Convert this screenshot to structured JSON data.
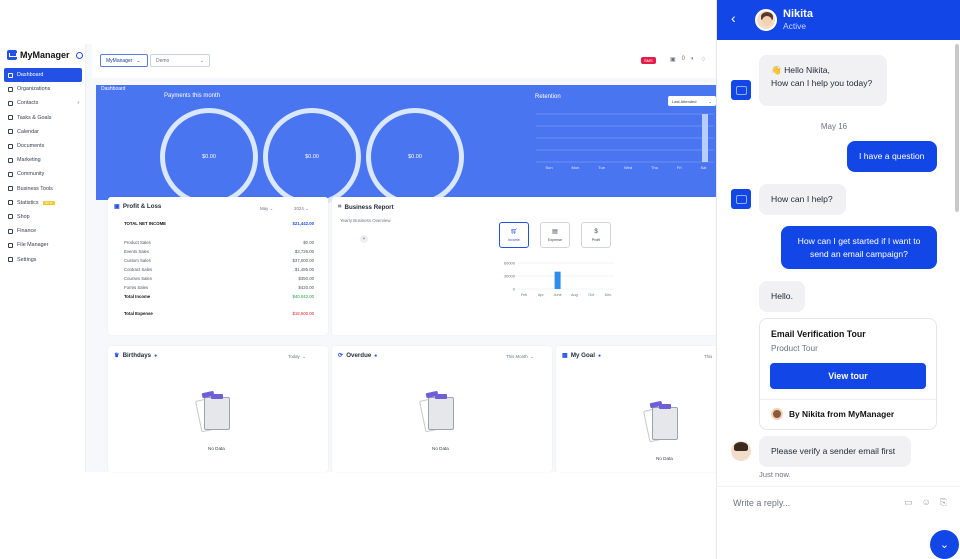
{
  "app": {
    "logo": "MyManager",
    "nav": [
      {
        "label": "Dashboard",
        "active": true
      },
      {
        "label": "Organizations"
      },
      {
        "label": "Contacts",
        "chevron": true
      },
      {
        "label": "Tasks & Goals"
      },
      {
        "label": "Calendar"
      },
      {
        "label": "Documents"
      },
      {
        "label": "Marketing"
      },
      {
        "label": "Community"
      },
      {
        "label": "Business Tools"
      },
      {
        "label": "Statistics",
        "badge": "NEW"
      },
      {
        "label": "Shop"
      },
      {
        "label": "Finance"
      },
      {
        "label": "File Manager"
      },
      {
        "label": "Settings"
      }
    ],
    "topbar": {
      "select1": "MyManager",
      "select2": "Demo",
      "yt_label": "SMS",
      "bell_count": "0"
    },
    "hero": {
      "section_label": "Dashboard",
      "payments_title": "Payments this month",
      "rings": [
        "$0.00",
        "$0.00",
        "$0.00"
      ],
      "retention_title": "Retention",
      "retention_select": "Last Attended",
      "retention_days": [
        "Sun",
        "Mon",
        "Tue",
        "Wed",
        "Thu",
        "Fri",
        "Sat"
      ]
    },
    "profit_loss": {
      "title": "Profit & Loss",
      "month": "May",
      "year": "2024",
      "total_net_label": "TOTAL NET INCOME",
      "total_net_value": "$21,442.00",
      "rows": [
        {
          "label": "Product Sales",
          "value": "$0.00"
        },
        {
          "label": "Events Sales",
          "value": "$3,726.00"
        },
        {
          "label": "Custom Sales",
          "value": "$37,000.00"
        },
        {
          "label": "Contract Sales",
          "value": "$1,485.00"
        },
        {
          "label": "Courses Sales",
          "value": "$350.00"
        },
        {
          "label": "Forms Sales",
          "value": "$420.00"
        }
      ],
      "total_income_label": "Total Income",
      "total_income_value": "$40,042.00",
      "total_expense_label": "Total Expense",
      "total_expense_value": "$18,600.00"
    },
    "business_report": {
      "title": "Business Report",
      "subtitle": "Yearly Business Overview",
      "buttons": [
        {
          "label": "Income",
          "icon": "cart-icon",
          "selected": true
        },
        {
          "label": "Expense",
          "icon": "document-icon"
        },
        {
          "label": "Profit",
          "icon": "dollar-icon"
        }
      ],
      "y_ticks": [
        "60000",
        "30000",
        "0"
      ],
      "months": [
        "Feb",
        "Apr",
        "June",
        "Aug",
        "Oct",
        "Dec"
      ]
    },
    "birthdays": {
      "title": "Birthdays",
      "filter": "Today",
      "empty": "No Data"
    },
    "overdue": {
      "title": "Overdue",
      "filter": "This Month",
      "empty": "No Data"
    },
    "my_goal": {
      "title": "My Goal",
      "filter": "This",
      "empty": "No Data"
    }
  },
  "chart_data": {
    "type": "bar",
    "categories": [
      "Feb",
      "Apr",
      "June",
      "Aug",
      "Oct",
      "Dec"
    ],
    "values": [
      0,
      0,
      40042,
      0,
      0,
      0
    ],
    "ylim": [
      0,
      60000
    ]
  },
  "chat": {
    "agent_name": "Nikita",
    "status": "Active",
    "messages": [
      {
        "from": "bot",
        "line1": "👋 Hello Nikita,",
        "line2": "How can I help you today?"
      },
      {
        "date": "May 16"
      },
      {
        "from": "user",
        "text": "I have a question"
      },
      {
        "from": "bot",
        "text": "How can I help?"
      },
      {
        "from": "user",
        "line1": "How can I get started if I want to",
        "line2": "send an email campaign?"
      },
      {
        "from": "bot",
        "text": "Hello."
      },
      {
        "from": "user2",
        "text": "Please verify a sender email first"
      }
    ],
    "tour": {
      "title": "Email Verification Tour",
      "subtitle": "Product Tour",
      "button": "View tour",
      "by": "By Nikita from MyManager"
    },
    "timestamp": "Just now.",
    "composer_placeholder": "Write a reply..."
  }
}
